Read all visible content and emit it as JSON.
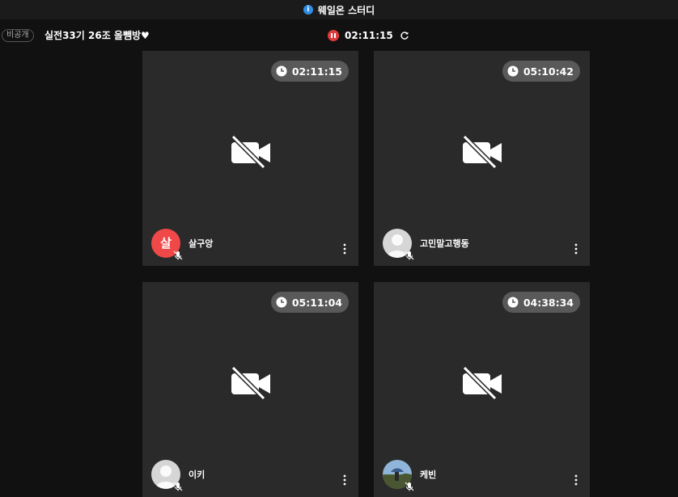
{
  "window": {
    "title": "웨일온 스터디"
  },
  "room": {
    "privacy": "비공개",
    "title": "실전33기 26조 올뺌방♥",
    "timer": "02:11:15"
  },
  "participants": [
    {
      "name": "살구앙",
      "time": "02:11:15",
      "avatar_type": "letter",
      "avatar_letter": "살",
      "avatar_color": "#f04848"
    },
    {
      "name": "고민말고행동",
      "time": "05:10:42",
      "avatar_type": "default"
    },
    {
      "name": "이키",
      "time": "05:11:04",
      "avatar_type": "default"
    },
    {
      "name": "케빈",
      "time": "04:38:34",
      "avatar_type": "photo"
    }
  ],
  "icons": {
    "camera": "video-off-icon",
    "mic": "mic-off-icon",
    "menu": "more-vertical-icon",
    "clock": "clock-icon",
    "info": "info-icon",
    "pause": "pause-icon",
    "refresh": "refresh-icon"
  },
  "colors": {
    "background": "#111111",
    "tile": "#2a2a2a",
    "pill": "#595959",
    "accent_red": "#e03a3a",
    "info_blue": "#2f8fe6"
  }
}
